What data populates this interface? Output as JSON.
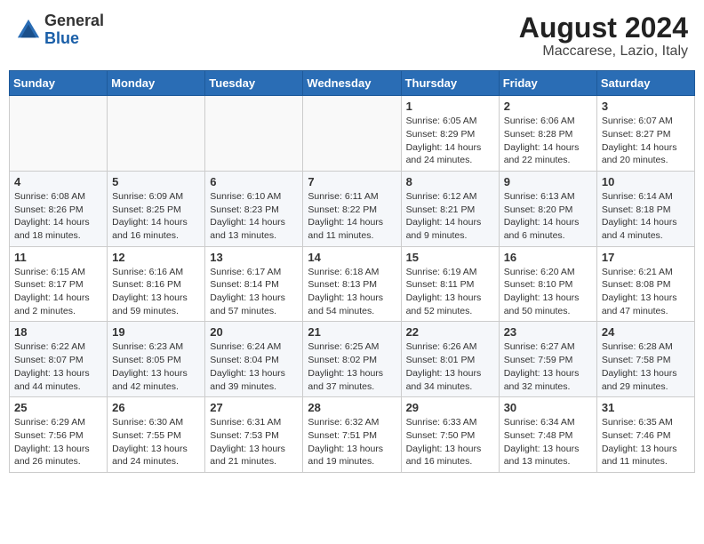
{
  "header": {
    "logo_general": "General",
    "logo_blue": "Blue",
    "month_year": "August 2024",
    "location": "Maccarese, Lazio, Italy"
  },
  "weekdays": [
    "Sunday",
    "Monday",
    "Tuesday",
    "Wednesday",
    "Thursday",
    "Friday",
    "Saturday"
  ],
  "weeks": [
    [
      {
        "day": "",
        "info": ""
      },
      {
        "day": "",
        "info": ""
      },
      {
        "day": "",
        "info": ""
      },
      {
        "day": "",
        "info": ""
      },
      {
        "day": "1",
        "info": "Sunrise: 6:05 AM\nSunset: 8:29 PM\nDaylight: 14 hours\nand 24 minutes."
      },
      {
        "day": "2",
        "info": "Sunrise: 6:06 AM\nSunset: 8:28 PM\nDaylight: 14 hours\nand 22 minutes."
      },
      {
        "day": "3",
        "info": "Sunrise: 6:07 AM\nSunset: 8:27 PM\nDaylight: 14 hours\nand 20 minutes."
      }
    ],
    [
      {
        "day": "4",
        "info": "Sunrise: 6:08 AM\nSunset: 8:26 PM\nDaylight: 14 hours\nand 18 minutes."
      },
      {
        "day": "5",
        "info": "Sunrise: 6:09 AM\nSunset: 8:25 PM\nDaylight: 14 hours\nand 16 minutes."
      },
      {
        "day": "6",
        "info": "Sunrise: 6:10 AM\nSunset: 8:23 PM\nDaylight: 14 hours\nand 13 minutes."
      },
      {
        "day": "7",
        "info": "Sunrise: 6:11 AM\nSunset: 8:22 PM\nDaylight: 14 hours\nand 11 minutes."
      },
      {
        "day": "8",
        "info": "Sunrise: 6:12 AM\nSunset: 8:21 PM\nDaylight: 14 hours\nand 9 minutes."
      },
      {
        "day": "9",
        "info": "Sunrise: 6:13 AM\nSunset: 8:20 PM\nDaylight: 14 hours\nand 6 minutes."
      },
      {
        "day": "10",
        "info": "Sunrise: 6:14 AM\nSunset: 8:18 PM\nDaylight: 14 hours\nand 4 minutes."
      }
    ],
    [
      {
        "day": "11",
        "info": "Sunrise: 6:15 AM\nSunset: 8:17 PM\nDaylight: 14 hours\nand 2 minutes."
      },
      {
        "day": "12",
        "info": "Sunrise: 6:16 AM\nSunset: 8:16 PM\nDaylight: 13 hours\nand 59 minutes."
      },
      {
        "day": "13",
        "info": "Sunrise: 6:17 AM\nSunset: 8:14 PM\nDaylight: 13 hours\nand 57 minutes."
      },
      {
        "day": "14",
        "info": "Sunrise: 6:18 AM\nSunset: 8:13 PM\nDaylight: 13 hours\nand 54 minutes."
      },
      {
        "day": "15",
        "info": "Sunrise: 6:19 AM\nSunset: 8:11 PM\nDaylight: 13 hours\nand 52 minutes."
      },
      {
        "day": "16",
        "info": "Sunrise: 6:20 AM\nSunset: 8:10 PM\nDaylight: 13 hours\nand 50 minutes."
      },
      {
        "day": "17",
        "info": "Sunrise: 6:21 AM\nSunset: 8:08 PM\nDaylight: 13 hours\nand 47 minutes."
      }
    ],
    [
      {
        "day": "18",
        "info": "Sunrise: 6:22 AM\nSunset: 8:07 PM\nDaylight: 13 hours\nand 44 minutes."
      },
      {
        "day": "19",
        "info": "Sunrise: 6:23 AM\nSunset: 8:05 PM\nDaylight: 13 hours\nand 42 minutes."
      },
      {
        "day": "20",
        "info": "Sunrise: 6:24 AM\nSunset: 8:04 PM\nDaylight: 13 hours\nand 39 minutes."
      },
      {
        "day": "21",
        "info": "Sunrise: 6:25 AM\nSunset: 8:02 PM\nDaylight: 13 hours\nand 37 minutes."
      },
      {
        "day": "22",
        "info": "Sunrise: 6:26 AM\nSunset: 8:01 PM\nDaylight: 13 hours\nand 34 minutes."
      },
      {
        "day": "23",
        "info": "Sunrise: 6:27 AM\nSunset: 7:59 PM\nDaylight: 13 hours\nand 32 minutes."
      },
      {
        "day": "24",
        "info": "Sunrise: 6:28 AM\nSunset: 7:58 PM\nDaylight: 13 hours\nand 29 minutes."
      }
    ],
    [
      {
        "day": "25",
        "info": "Sunrise: 6:29 AM\nSunset: 7:56 PM\nDaylight: 13 hours\nand 26 minutes."
      },
      {
        "day": "26",
        "info": "Sunrise: 6:30 AM\nSunset: 7:55 PM\nDaylight: 13 hours\nand 24 minutes."
      },
      {
        "day": "27",
        "info": "Sunrise: 6:31 AM\nSunset: 7:53 PM\nDaylight: 13 hours\nand 21 minutes."
      },
      {
        "day": "28",
        "info": "Sunrise: 6:32 AM\nSunset: 7:51 PM\nDaylight: 13 hours\nand 19 minutes."
      },
      {
        "day": "29",
        "info": "Sunrise: 6:33 AM\nSunset: 7:50 PM\nDaylight: 13 hours\nand 16 minutes."
      },
      {
        "day": "30",
        "info": "Sunrise: 6:34 AM\nSunset: 7:48 PM\nDaylight: 13 hours\nand 13 minutes."
      },
      {
        "day": "31",
        "info": "Sunrise: 6:35 AM\nSunset: 7:46 PM\nDaylight: 13 hours\nand 11 minutes."
      }
    ]
  ]
}
